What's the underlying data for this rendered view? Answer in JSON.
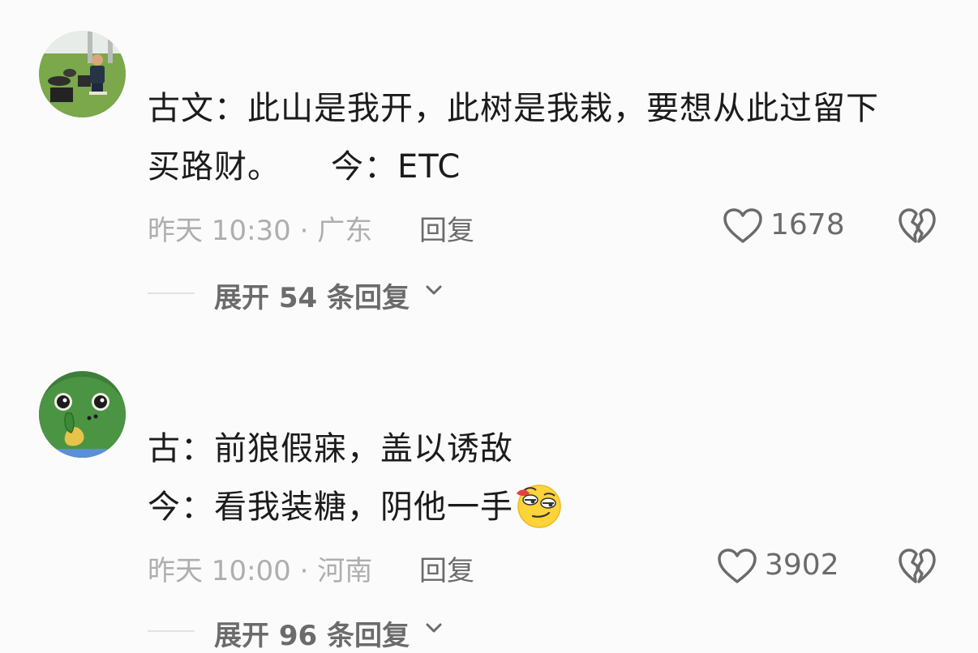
{
  "comments": [
    {
      "avatar": "photo-avatar",
      "text_line1": "古文：此山是我开，此树是我栽，要想从此过留下",
      "text_line2a": "买路财。",
      "text_line2b": "今：ETC",
      "meta": "昨天 10:30 · 广东",
      "reply_label": "回复",
      "likes": "1678",
      "expand_label": "展开 54 条回复",
      "icons": {
        "like": "heart-outline-icon",
        "dislike": "broken-heart-icon",
        "expand": "chevron-down-icon"
      }
    },
    {
      "avatar": "green-cartoon-avatar",
      "text_line1": "古：前狼假寐，盖以诱敌",
      "text_line2": "今：看我装糖，阴他一手",
      "emoji": "sly-smirk-emoji",
      "meta": "昨天 10:00 · 河南",
      "reply_label": "回复",
      "likes": "3902",
      "expand_label": "展开 96 条回复",
      "icons": {
        "like": "heart-outline-icon",
        "dislike": "broken-heart-icon",
        "expand": "chevron-down-icon"
      }
    }
  ],
  "colors": {
    "background": "#fbfbfb",
    "primary_text": "#1b1b1b",
    "meta_text": "#aeaeae",
    "action_text": "#6b6b6b"
  }
}
